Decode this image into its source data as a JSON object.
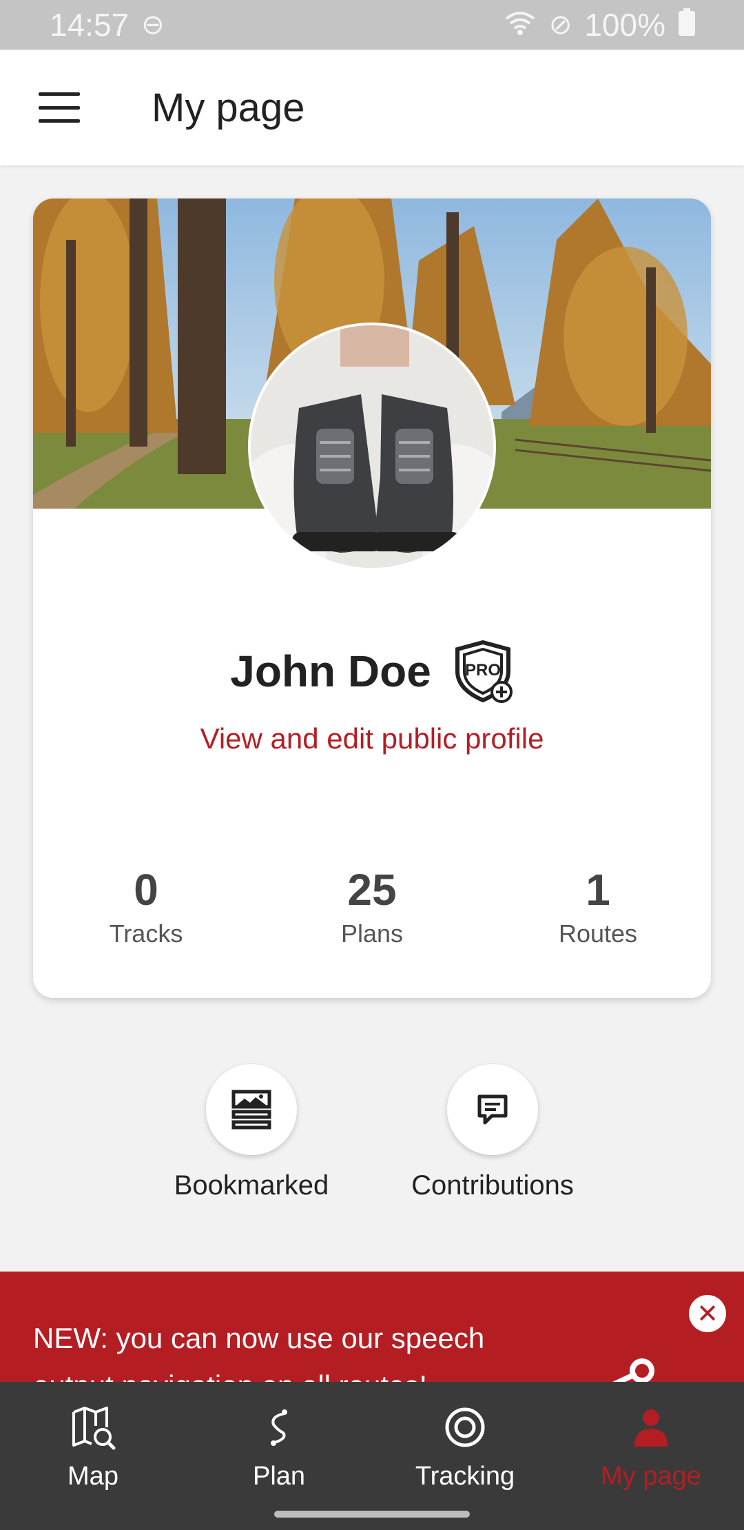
{
  "status_bar": {
    "time": "14:57",
    "battery": "100%"
  },
  "app_bar": {
    "title": "My page"
  },
  "profile": {
    "name": "John Doe",
    "badge": "PRO",
    "link_label": "View and edit public profile",
    "stats": [
      {
        "value": "0",
        "label": "Tracks"
      },
      {
        "value": "25",
        "label": "Plans"
      },
      {
        "value": "1",
        "label": "Routes"
      }
    ]
  },
  "actions": [
    {
      "label": "Bookmarked",
      "icon": "bookmark-list-icon"
    },
    {
      "label": "Contributions",
      "icon": "comment-icon"
    }
  ],
  "banner": {
    "text": "NEW: you can now use our speech output navigation on all routes!"
  },
  "bottom_nav": [
    {
      "label": "Map",
      "icon": "map-search-icon",
      "active": false
    },
    {
      "label": "Plan",
      "icon": "route-plan-icon",
      "active": false
    },
    {
      "label": "Tracking",
      "icon": "target-icon",
      "active": false
    },
    {
      "label": "My page",
      "icon": "person-icon",
      "active": true
    }
  ],
  "colors": {
    "accent": "#b41e23",
    "nav_bg": "#3a3a3a",
    "page_bg": "#f2f2f2"
  }
}
